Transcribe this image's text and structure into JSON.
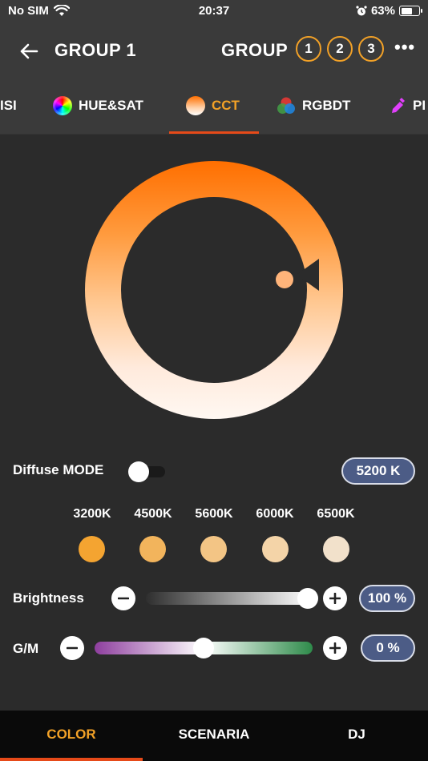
{
  "status_bar": {
    "carrier": "No SIM",
    "time": "20:37",
    "battery": "63%",
    "battery_level": 0.63
  },
  "header": {
    "title": "GROUP 1",
    "group_label": "GROUP",
    "group_numbers": [
      "1",
      "2",
      "3"
    ],
    "more": "•••"
  },
  "tabs": [
    {
      "label": "ISI"
    },
    {
      "label": "HUE&SAT"
    },
    {
      "label": "CCT",
      "active": true
    },
    {
      "label": "RGBDT"
    },
    {
      "label": "PI"
    }
  ],
  "cct": {
    "diffuse_label": "Diffuse MODE",
    "diffuse_on": false,
    "kelvin": "5200 K",
    "presets": [
      {
        "label": "3200K",
        "color": "#f4a431"
      },
      {
        "label": "4500K",
        "color": "#f2b45c"
      },
      {
        "label": "5600K",
        "color": "#f3c585"
      },
      {
        "label": "6000K",
        "color": "#f4d4a8"
      },
      {
        "label": "6500K",
        "color": "#f2e1cb"
      }
    ]
  },
  "brightness": {
    "label": "Brightness",
    "value": "100 %",
    "level": 1.0
  },
  "gm": {
    "label": "G/M",
    "value": "0 %",
    "level": 0.0
  },
  "bottom_nav": {
    "items": [
      "COLOR",
      "SCENARIA",
      "DJ"
    ],
    "active": "COLOR"
  },
  "colors": {
    "accent": "#f2a127",
    "underline": "#e64a19",
    "pill": "#4c5c86"
  }
}
